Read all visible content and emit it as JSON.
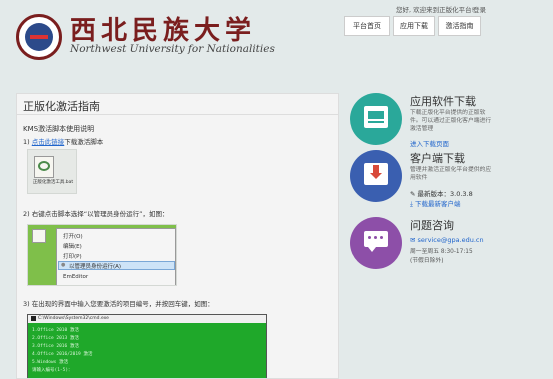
{
  "header": {
    "school_name_cn": "西北民族大学",
    "school_name_en": "Northwest University for Nationalities",
    "welcome_text": "您好, 欢迎来到正版化平台!",
    "logout": "登录",
    "nav": [
      "平台首页",
      "应用下载",
      "激活指南"
    ]
  },
  "main": {
    "title": "正版化激活指南",
    "section_heading": "KMS激活脚本使用说明",
    "steps": [
      {
        "num": "1)",
        "link": "点击此链接",
        "text": "下载激活脚本"
      },
      {
        "num": "2)",
        "text": "右键点击脚本选择“以管理员身份运行”，如图："
      },
      {
        "num": "3)",
        "text": "在出现的界面中输入您要激活的项目编号，并按回车键，如图："
      }
    ],
    "file_icon_label": "正版化激活工具.bat",
    "context_menu": [
      "打开(O)",
      "编辑(E)",
      "打印(P)",
      "以管理员身份运行(A)",
      "EmEditor"
    ],
    "cmd_title": "C:\\Windows\\System32\\cmd.exe",
    "cmd_lines": [
      "1.Office 2010 激活",
      "2.Office 2013 激活",
      "3.Office 2016 激活",
      "4.Office 2016/2019 激活",
      "5.Windows 激活",
      "",
      "请输入编号(1-5)："
    ]
  },
  "sidebar": {
    "app_download": {
      "title": "应用软件下载",
      "desc": "下载正版化平台提供的正版软件。可以通过正版化客户端进行激活管理",
      "link": "进入下载页面"
    },
    "client_download": {
      "title": "客户端下载",
      "desc": "管理并激活正版化平台提供的应用软件",
      "version": "最新版本：3.0.3.8",
      "link": "下载最新客户端"
    },
    "consult": {
      "title": "问题咨询",
      "email": "service@gpa.edu.cn",
      "hours": "周一至周五 8:30-17:15",
      "holiday": "(节假日除外)"
    }
  },
  "colors": {
    "teal": "#2aa89a",
    "blue": "#3a5fb0",
    "purple": "#8d4fa8",
    "brand_red": "#7a1e1e",
    "cmd_green": "#1fa82a"
  }
}
